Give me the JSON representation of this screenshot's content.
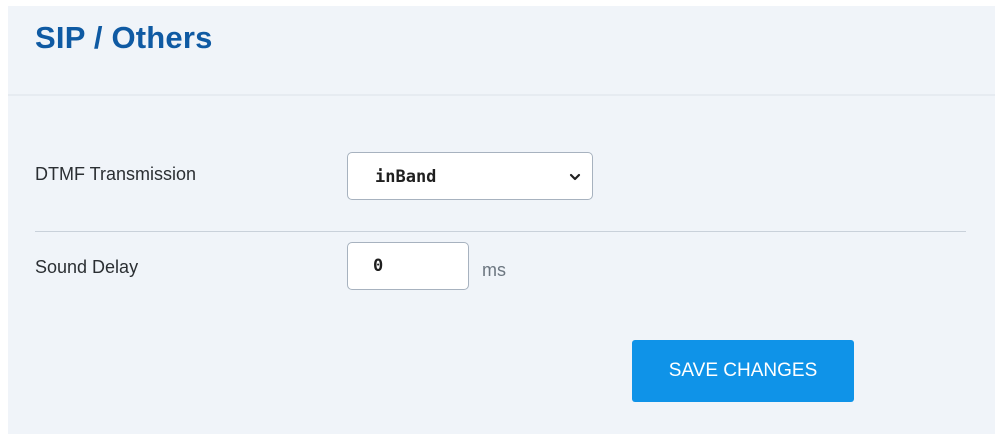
{
  "colors": {
    "title": "#0f5aa3",
    "panel_bg": "#f0f4f9",
    "button_bg": "#0f93e8",
    "button_text": "#ffffff"
  },
  "header": {
    "title": "SIP / Others"
  },
  "form": {
    "dtmf": {
      "label": "DTMF Transmission",
      "selected": "inBand",
      "icon": "chevron-down-icon"
    },
    "sound_delay": {
      "label": "Sound Delay",
      "value": "0",
      "unit": "ms"
    }
  },
  "actions": {
    "save_label": "SAVE CHANGES"
  }
}
